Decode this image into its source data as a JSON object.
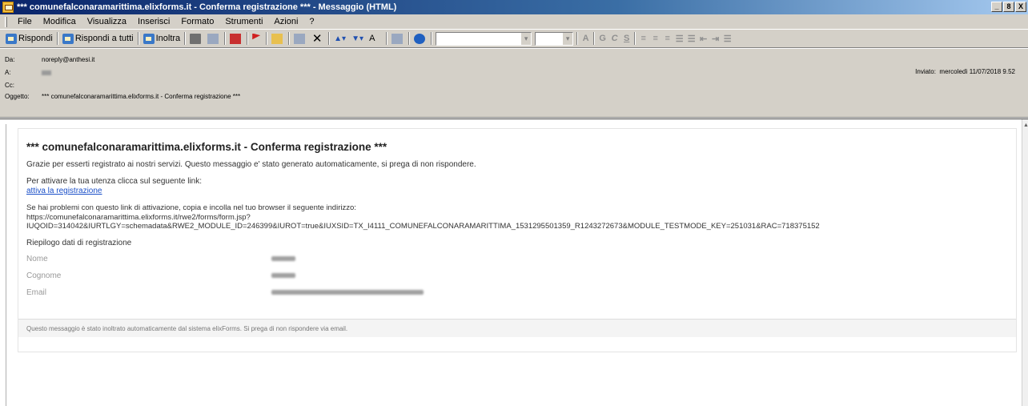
{
  "window": {
    "title": "*** comunefalconaramarittima.elixforms.it - Conferma registrazione *** - Messaggio (HTML)",
    "controls": [
      "_",
      "8",
      "X"
    ]
  },
  "menu": [
    "File",
    "Modifica",
    "Visualizza",
    "Inserisci",
    "Formato",
    "Strumenti",
    "Azioni",
    "?"
  ],
  "toolbar": {
    "reply": "Rispondi",
    "reply_all": "Rispondi a tutti",
    "forward": "Inoltra"
  },
  "header": {
    "from_label": "Da:",
    "from_value": "noreply@anthesi.it",
    "to_label": "A:",
    "cc_label": "Cc:",
    "subject_label": "Oggetto:",
    "subject_value": "*** comunefalconaramarittima.elixforms.it - Conferma registrazione ***",
    "sent_label": "Inviato:",
    "sent_value": "mercoledì 11/07/2018 9.52"
  },
  "message": {
    "title": "*** comunefalconaramarittima.elixforms.it - Conferma registrazione ***",
    "thanks": "Grazie per esserti registrato ai nostri servizi. Questo messaggio e' stato generato automaticamente, si prega di non rispondere.",
    "activate_intro": "Per attivare la tua utenza clicca sul seguente link:",
    "activate_link": "attiva la registrazione",
    "problem_text": "Se hai problemi con questo link di attivazione, copia e incolla nel tuo browser il seguente indirizzo:",
    "url_line1": "https://comunefalconaramarittima.elixforms.it/rwe2/forms/form.jsp?",
    "url_line2": "IUQOID=314042&IURTLGY=schemadata&RWE2_MODULE_ID=246399&IUROT=true&IUXSID=TX_I4111_COMUNEFALCONARAMARITTIMA_1531295501359_R1243272673&MODULE_TESTMODE_KEY=251031&RAC=718375152",
    "summary_title": "Riepilogo dati di registrazione",
    "fields": [
      {
        "label": "Nome"
      },
      {
        "label": "Cognome"
      },
      {
        "label": "Email"
      }
    ],
    "footer": "Questo messaggio è stato inoltrato automaticamente dal sistema elixForms. Si prega di non rispondere via email."
  }
}
